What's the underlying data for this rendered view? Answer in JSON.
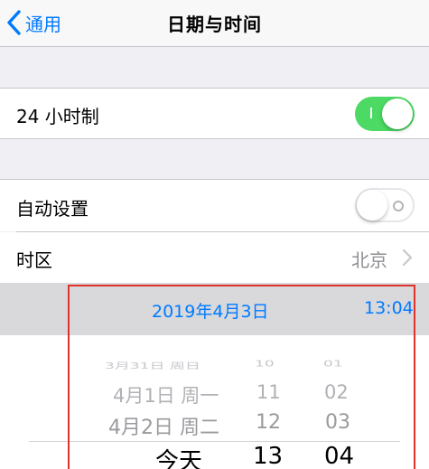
{
  "navbar": {
    "back_label": "通用",
    "title": "日期与时间"
  },
  "settings": {
    "hour24": {
      "label": "24 小时制",
      "enabled": true
    },
    "auto_set": {
      "label": "自动设置",
      "enabled": false
    },
    "timezone": {
      "label": "时区",
      "value": "北京"
    }
  },
  "date_bar": {
    "date": "2019年4月3日",
    "time": "13:04"
  },
  "picker": {
    "dates": [
      "3月31日 周日",
      "4月1日 周一",
      "4月2日 周二",
      "今天"
    ],
    "hours": [
      "10",
      "11",
      "12",
      "13"
    ],
    "minutes": [
      "01",
      "02",
      "03",
      "04"
    ]
  },
  "colors": {
    "accent": "#007aff",
    "toggle_on": "#4cd964",
    "highlight": "#e0322d"
  }
}
